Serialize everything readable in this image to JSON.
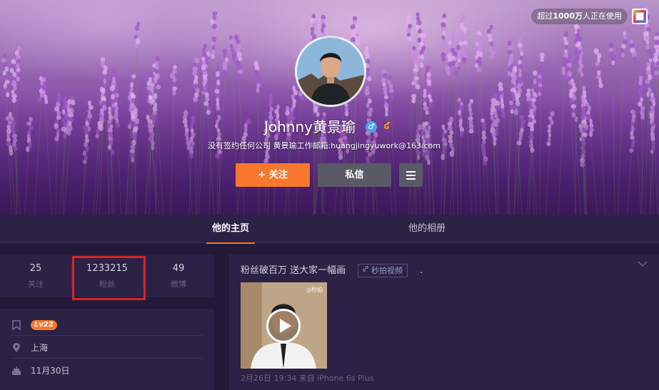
{
  "header": {
    "promo_prefix": "超过",
    "promo_highlight": "1000万",
    "promo_suffix": "人正在使用"
  },
  "profile": {
    "name": "Johnny黄景瑜",
    "gender_symbol": "♂",
    "badge_symbol": "ʛ",
    "bio": "没有签约任何公司 黄景瑜工作邮箱:huangjingyuwork@163.com",
    "follow_label": "+ 关注",
    "message_label": "私信"
  },
  "tabs": {
    "home": "他的主页",
    "album": "他的相册"
  },
  "stats": {
    "following_count": "25",
    "following_label": "关注",
    "fans_count": "1233215",
    "fans_label": "粉丝",
    "posts_count": "49",
    "posts_label": "微博"
  },
  "info": {
    "level": "Lv22",
    "location": "上海",
    "birthday": "11月30日"
  },
  "post": {
    "text": "粉丝破百万 送大家一幅画",
    "video_tag": "秒拍视频",
    "trailing": ".",
    "watermark": "◎秒拍",
    "meta": "2月26日 19:34 来自 iPhone 6s Plus"
  },
  "colors": {
    "accent": "#f7782c",
    "page_background": "#231a3a",
    "card_background": "#2c2245",
    "highlight_border": "#d8232a"
  },
  "icons": {
    "skin": "skin-icon",
    "more": "menu-icon",
    "level": "bookmark-icon",
    "location": "location-pin-icon",
    "birthday": "cake-icon",
    "video": "link-icon",
    "expand": "chevron-down-icon",
    "play": "play-icon"
  }
}
